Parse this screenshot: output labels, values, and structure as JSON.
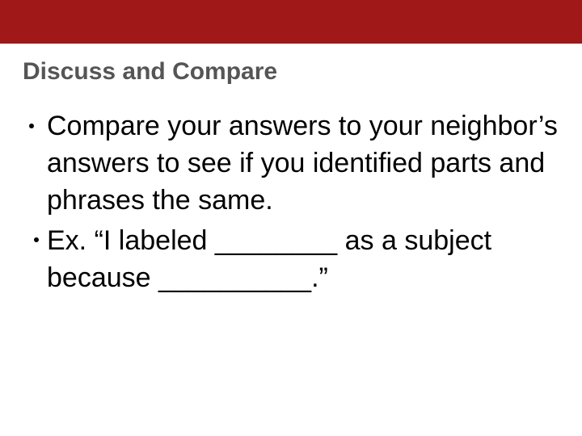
{
  "slide": {
    "title": "Discuss and Compare",
    "bullets": [
      {
        "text": "Compare your answers to your neighbor’s answers to see if you identified parts and phrases the same."
      },
      {
        "text": " Ex. “I labeled ________ as a subject because __________.”"
      }
    ],
    "colors": {
      "banner": "#a01818",
      "title": "#555555",
      "body": "#000000"
    }
  }
}
